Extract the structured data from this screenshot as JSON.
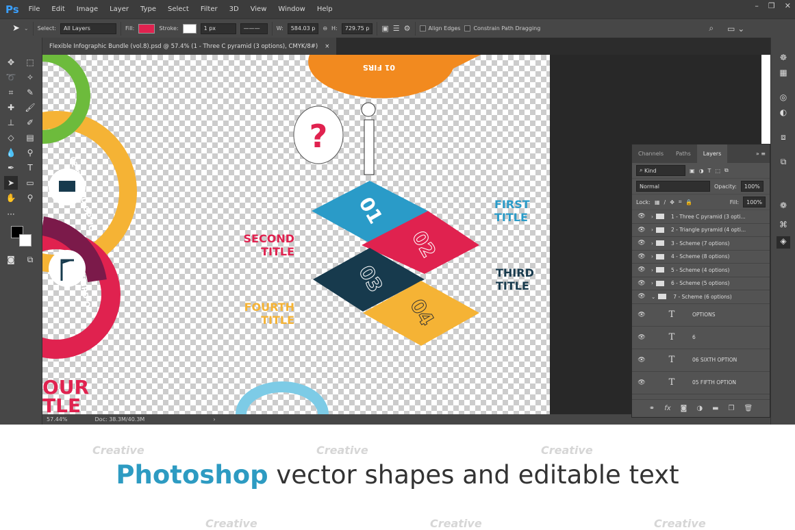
{
  "app": {
    "logo": "Ps",
    "menu": [
      "File",
      "Edit",
      "Image",
      "Layer",
      "Type",
      "Select",
      "Filter",
      "3D",
      "View",
      "Window",
      "Help"
    ],
    "window_controls": [
      "–",
      "❐",
      "✕"
    ]
  },
  "options": {
    "select_label": "Select:",
    "select_value": "All Layers",
    "fill_label": "Fill:",
    "fill_color": "#e0224f",
    "stroke_label": "Stroke:",
    "stroke_width": "1 px",
    "w_label": "W:",
    "w_value": "584.03 p",
    "h_label": "H:",
    "h_value": "729.75 p",
    "align_edges": "Align Edges",
    "constrain": "Constrain Path Dragging"
  },
  "document": {
    "tab_title": "Flexible Infographic Bundle (vol.8).psd @ 57.4% (1 - Three C pyramid (3 options), CMYK/8#)",
    "close": "×",
    "zoom": "57.44%",
    "doc_size": "Doc: 38.3M/40.3M"
  },
  "canvas": {
    "titles": [
      {
        "line1": "FIRST",
        "line2": "TITLE",
        "color": "#2a9bc8"
      },
      {
        "line1": "SECOND",
        "line2": "TITLE",
        "color": "#e0224f"
      },
      {
        "line1": "THIRD",
        "line2": "TITLE",
        "color": "#173a4d"
      },
      {
        "line1": "FOURTH",
        "line2": "TITLE",
        "color": "#f5b335"
      }
    ],
    "digits": [
      "01",
      "02",
      "03",
      "04"
    ],
    "ring_labels": [
      "02 SECOND OPTIO",
      "03 THIRD O",
      "01 FIRS",
      "OUR",
      "TLE"
    ]
  },
  "layers_panel": {
    "tabs": [
      "Channels",
      "Paths",
      "Layers"
    ],
    "kind": "Kind",
    "blend": "Normal",
    "opacity_label": "Opacity:",
    "opacity": "100%",
    "lock_label": "Lock:",
    "fill_label": "Fill:",
    "fill": "100%",
    "groups": [
      "1 - Three C pyramid (3 opti...",
      "2 - Triangle pyramid (4 opti...",
      "3 - Scheme (7 options)",
      "4 - Scheme (8 options)",
      "5 - Scheme (4 options)",
      "6 - Scheme (5 options)",
      "7 - Scheme (6 options)"
    ],
    "text_layers": [
      "OPTIONS",
      "6",
      "06 SIXTH  OPTION",
      "05 FIFTH  OPTION"
    ]
  },
  "caption": {
    "bold": "Photoshop",
    "rest": " vector shapes and editable text"
  },
  "watermark": "Creative"
}
